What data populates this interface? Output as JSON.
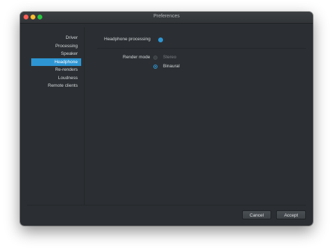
{
  "window": {
    "title": "Preferences",
    "traffic_colors": {
      "close": "#fd5f57",
      "minimize": "#febc2e",
      "maximize": "#28c840"
    }
  },
  "sidebar": {
    "items": [
      {
        "label": "Driver",
        "active": false
      },
      {
        "label": "Processing",
        "active": false
      },
      {
        "label": "Speaker",
        "active": false
      },
      {
        "label": "Headphone",
        "active": true
      },
      {
        "label": "Re-renders",
        "active": false
      },
      {
        "label": "Loudness",
        "active": false
      },
      {
        "label": "Remote clients",
        "active": false
      }
    ],
    "active_color": "#2e95d3"
  },
  "headphone": {
    "processing_label": "Headphone processing",
    "processing_enabled": true,
    "render_mode_label": "Render mode",
    "options": [
      {
        "label": "Stereo",
        "checked": false
      },
      {
        "label": "Binaural",
        "checked": true
      }
    ]
  },
  "footer": {
    "cancel_label": "Cancel",
    "accept_label": "Accept"
  }
}
